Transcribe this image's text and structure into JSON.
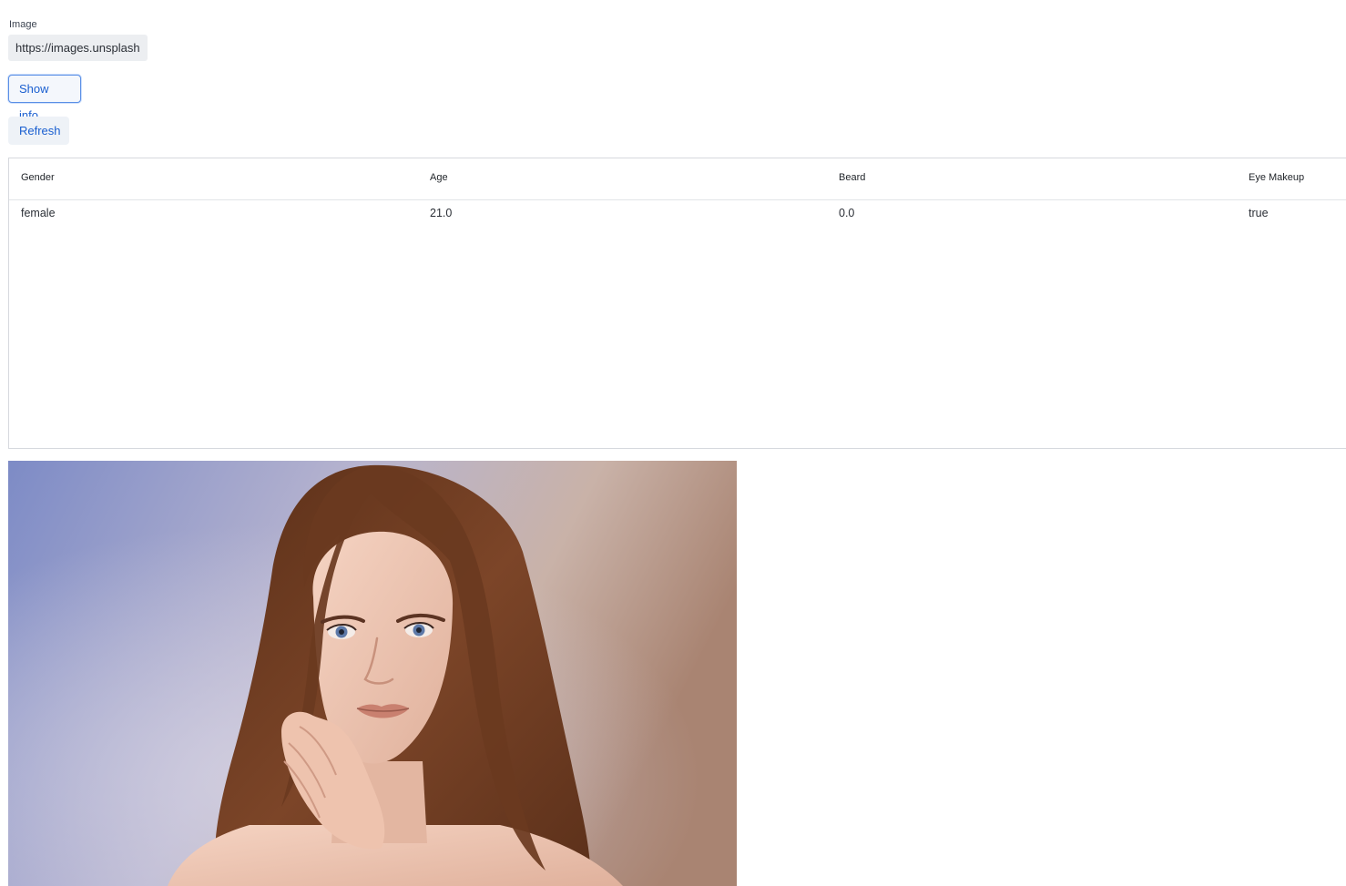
{
  "image_field": {
    "label": "Image",
    "value": "https://images.unsplash"
  },
  "buttons": {
    "show_info": "Show info",
    "refresh": "Refresh"
  },
  "table": {
    "columns": [
      "Gender",
      "Age",
      "Beard",
      "Eye Makeup"
    ],
    "rows": [
      [
        "female",
        "21.0",
        "0.0",
        "true"
      ]
    ]
  },
  "photo": {
    "subject": "portrait-photo",
    "colors": {
      "background_left": "#7f8cc4",
      "background_right": "#b89a88",
      "hair": "#6e3d22",
      "skin": "#efc8b4"
    }
  }
}
